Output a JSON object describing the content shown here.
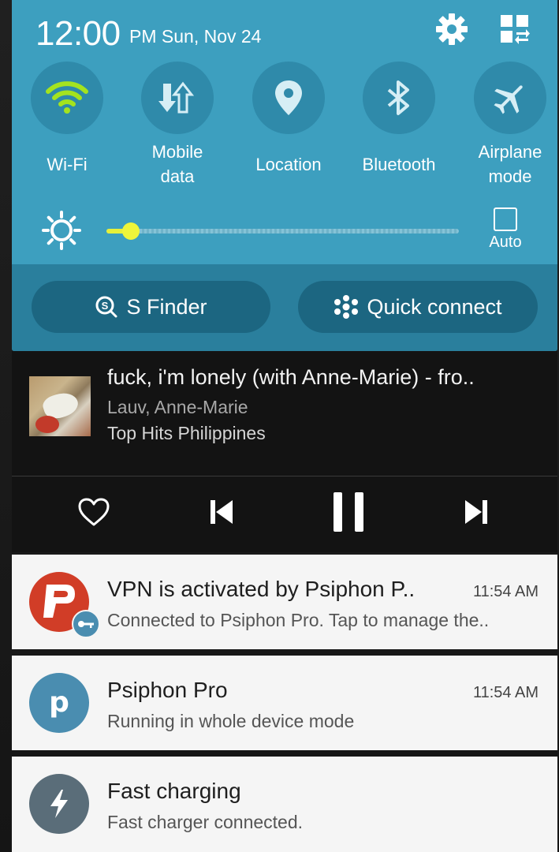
{
  "status": {
    "time": "12:00",
    "date": "PM Sun, Nov 24"
  },
  "toggles": [
    {
      "label": "Wi-Fi",
      "icon": "wifi-icon",
      "active": true
    },
    {
      "label": "Mobile\ndata",
      "icon": "mobile-data-icon",
      "active": false
    },
    {
      "label": "Location",
      "icon": "location-icon",
      "active": false
    },
    {
      "label": "Bluetooth",
      "icon": "bluetooth-icon",
      "active": false
    },
    {
      "label": "Airplane\nmode",
      "icon": "airplane-icon",
      "active": false
    }
  ],
  "brightness": {
    "level": 0.07,
    "auto_label": "Auto",
    "auto_checked": false
  },
  "actions": {
    "s_finder": "S Finder",
    "quick_connect": "Quick connect"
  },
  "media": {
    "title": "fuck, i'm lonely (with Anne-Marie) - fro..",
    "artist": "Lauv, Anne-Marie",
    "source": "Top Hits Philippines"
  },
  "notifications": [
    {
      "title": "VPN is activated by Psiphon P..",
      "text": "Connected to Psiphon Pro. Tap to manage the..",
      "time": "11:54 AM"
    },
    {
      "title": "Psiphon Pro",
      "text": "Running in whole device mode",
      "time": "11:54 AM"
    },
    {
      "title": "Fast charging",
      "text": "Fast charger connected.",
      "time": ""
    }
  ],
  "colors": {
    "panel": "#3d9fbf",
    "toggle_active": "#a4e31f",
    "slider": "#e6f03a",
    "psiphon_red": "#d13d27",
    "psiphon_blue": "#4a8db0",
    "charging_gray": "#5a6d79"
  }
}
